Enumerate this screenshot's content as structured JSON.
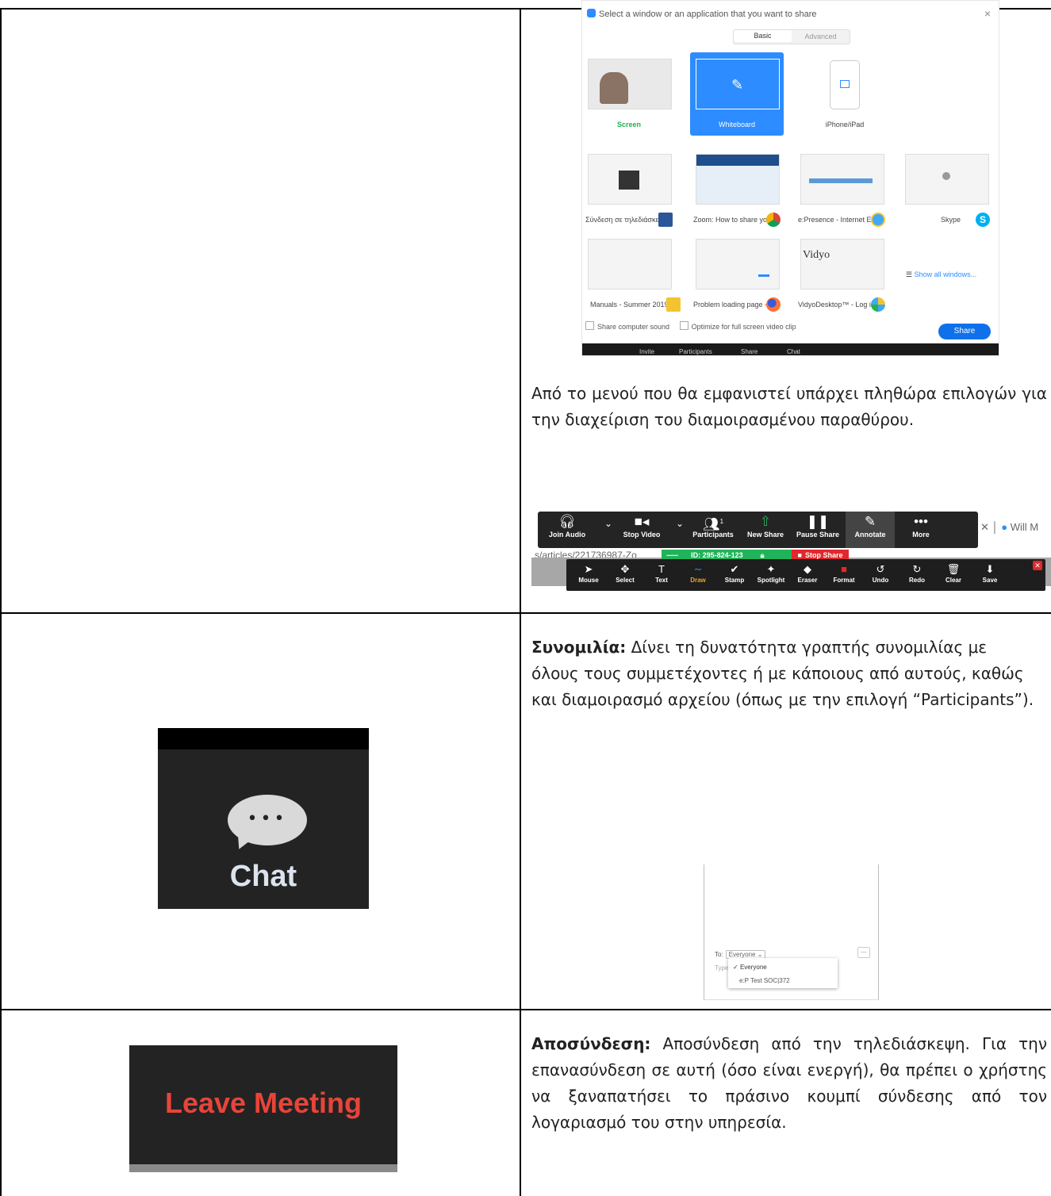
{
  "row1": {
    "share_dialog": {
      "title": "Select a window or an application that you want to share",
      "close": "×",
      "tabs": [
        "Basic",
        "Advanced"
      ],
      "items": [
        {
          "label": "Screen",
          "label_color": "#22b14c"
        },
        {
          "label": "Whiteboard",
          "selected": true
        },
        {
          "label": "iPhone/iPad"
        },
        {
          "label": "Σύνδεση σε τηλεδιάσκεψ..."
        },
        {
          "label": "Zoom: How to share you..."
        },
        {
          "label": "e:Presence - Internet Exp..."
        },
        {
          "label": "Skype"
        },
        {
          "label": "Manuals - Summer 2019"
        },
        {
          "label": "Problem loading page - ..."
        },
        {
          "label": "VidyoDesktop™ - Log in"
        }
      ],
      "show_all": "Show all windows...",
      "vidyo_text": "Vidyo",
      "share_sound": "Share computer sound",
      "optimize": "Optimize for full screen video clip",
      "share_button": "Share",
      "bottom_bar": [
        "Invite",
        "Participants",
        "Share",
        "Chat"
      ]
    },
    "description": "Από το μενού που θα εμφανιστεί υπάρχει πληθώρα επιλογών για την διαχείριση του διαμοιρασμένου παραθύρου.",
    "toolbar": {
      "items": [
        "Join Audio",
        "Stop Video",
        "Participants",
        "New Share",
        "Pause Share",
        "Annotate",
        "More"
      ],
      "participants_count": "1",
      "will_text": "Will M",
      "url": "s/articles/221736987-Zo",
      "meeting_id": "ID: 295-824-123",
      "stop_share": "Stop Share",
      "annotate_tools": [
        "Mouse",
        "Select",
        "Text",
        "Draw",
        "Stamp",
        "Spotlight",
        "Eraser",
        "Format",
        "Undo",
        "Redo",
        "Clear",
        "Save"
      ]
    }
  },
  "row2": {
    "tile_label": "Chat",
    "title": "Συνομιλία:",
    "text": "Δίνει τη δυνατότητα γραπτής συνομιλίας με όλους τους συμμετέχοντες ή με κάποιους από αυτούς, καθώς και διαμοιρασμό αρχείου (όπως με την επιλογή “Participants”).",
    "panel": {
      "to_label": "To:",
      "recipient": "Everyone",
      "type_hint": "Type",
      "more": "...",
      "options": [
        "Everyone",
        "e:P Test SOC|372"
      ]
    }
  },
  "row3": {
    "tile_label": "Leave Meeting",
    "title": "Αποσύνδεση:",
    "text": "Αποσύνδεση από την τηλεδιάσκεψη. Για την επανασύνδεση σε αυτή (όσο είναι ενεργή), θα πρέπει ο χρήστης να ξαναπατήσει το πράσινο κουμπί σύνδεσης από τον λογαριασμό του στην υπηρεσία."
  }
}
